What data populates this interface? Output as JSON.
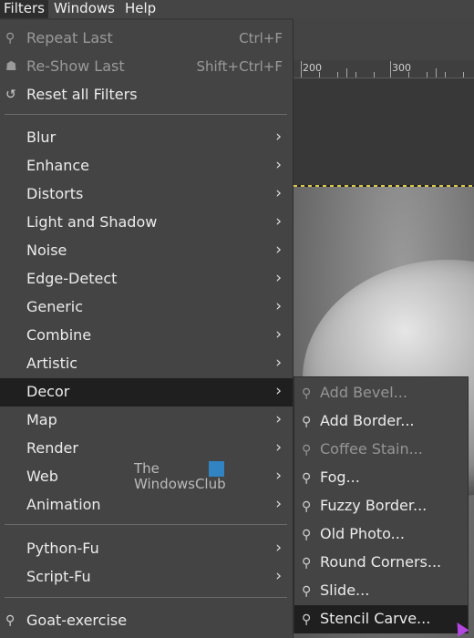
{
  "menubar": {
    "filters": "Filters",
    "windows": "Windows",
    "help": "Help"
  },
  "ruler": {
    "label_200": "200",
    "label_300": "300"
  },
  "filters_menu": {
    "repeat_last": {
      "label": "Repeat Last",
      "accel": "Ctrl+F",
      "icon": "repeat-icon"
    },
    "reshow_last": {
      "label": "Re-Show Last",
      "accel": "Shift+Ctrl+F",
      "icon": "reshow-icon"
    },
    "reset_all": {
      "label": "Reset all Filters",
      "icon": "reset-icon"
    },
    "items": [
      {
        "label": "Blur"
      },
      {
        "label": "Enhance"
      },
      {
        "label": "Distorts"
      },
      {
        "label": "Light and Shadow"
      },
      {
        "label": "Noise"
      },
      {
        "label": "Edge-Detect"
      },
      {
        "label": "Generic"
      },
      {
        "label": "Combine"
      },
      {
        "label": "Artistic"
      },
      {
        "label": "Decor",
        "selected": true
      },
      {
        "label": "Map"
      },
      {
        "label": "Render"
      },
      {
        "label": "Web"
      },
      {
        "label": "Animation"
      }
    ],
    "scripts": [
      {
        "label": "Python-Fu"
      },
      {
        "label": "Script-Fu"
      }
    ],
    "goat": {
      "label": "Goat-exercise",
      "icon": "plugin-icon"
    }
  },
  "decor_submenu": {
    "items": [
      {
        "label": "Add Bevel...",
        "disabled": true
      },
      {
        "label": "Add Border..."
      },
      {
        "label": "Coffee Stain...",
        "disabled": true
      },
      {
        "label": "Fog..."
      },
      {
        "label": "Fuzzy Border..."
      },
      {
        "label": "Old Photo..."
      },
      {
        "label": "Round Corners..."
      },
      {
        "label": "Slide..."
      },
      {
        "label": "Stencil Carve...",
        "selected": true
      }
    ]
  },
  "watermark": {
    "line1": "The",
    "line2": "WindowsClub"
  },
  "colors": {
    "menu_bg": "#444444",
    "selected_bg": "#1f1f1f",
    "disabled_text": "#9a9a9a",
    "selection_marquee": "#d8c84a",
    "cursor": "#b146e0"
  }
}
